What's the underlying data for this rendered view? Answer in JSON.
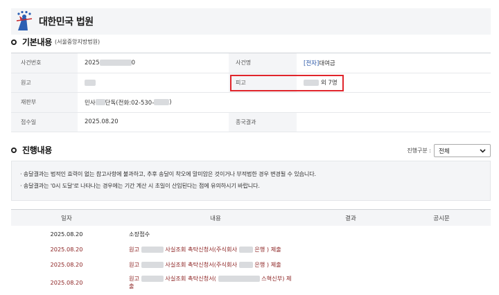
{
  "header": {
    "court_name": "대한민국 법원"
  },
  "basic": {
    "title": "기본내용",
    "subtitle": "(서울중앙지방법원)",
    "fields": {
      "case_no_label": "사건번호",
      "case_no_value_pre": "2025",
      "case_no_value_post": "0",
      "case_name_label": "사건명",
      "case_name_tag": "[전자]",
      "case_name_value": "대여금",
      "plaintiff_label": "원고",
      "defendant_label": "피고",
      "defendant_value": "외 7명",
      "court_div_label": "재판부",
      "court_div_pre": "민사",
      "court_div_mid": "단독(전화:02-530-",
      "court_div_post": ")",
      "received_label": "접수일",
      "received_value": "2025.08.20",
      "final_label": "종국결과",
      "final_value": ""
    }
  },
  "progress": {
    "title": "진행내용",
    "filter_label": "진행구분 :",
    "filter_value": "전체",
    "notices": [
      "· 송달결과는 법적인 효력이 없는 참고사항에 불과하고, 추후 송달이 착오에 말미암은 것이거나 부적법한 경우 변경될 수 있습니다.",
      "· 송달결과는 '0시 도달'로 나타나는 경우에는 기간 계산 시 초일이 산입된다는 점에 유의하시기 바랍니다."
    ],
    "columns": {
      "date": "일자",
      "content": "내용",
      "result": "결과",
      "public": "공시문"
    },
    "rows": [
      {
        "date": "2025.08.20",
        "content": "소장접수"
      },
      {
        "date": "2025.08.20",
        "c1": "원고",
        "c2": "사실조회 촉탁신청서(주식회사",
        "c3": "은행 ) 제출"
      },
      {
        "date": "2025.08.20",
        "c1": "원고",
        "c2": "사실조회 촉탁신청서(주식회사",
        "c3": "은행 ) 제출"
      },
      {
        "date": "2025.08.20",
        "c1": "원고",
        "c2": "사실조회 촉탁신청서(",
        "c3": "스혁신부) 제",
        "c4": "출"
      }
    ]
  }
}
